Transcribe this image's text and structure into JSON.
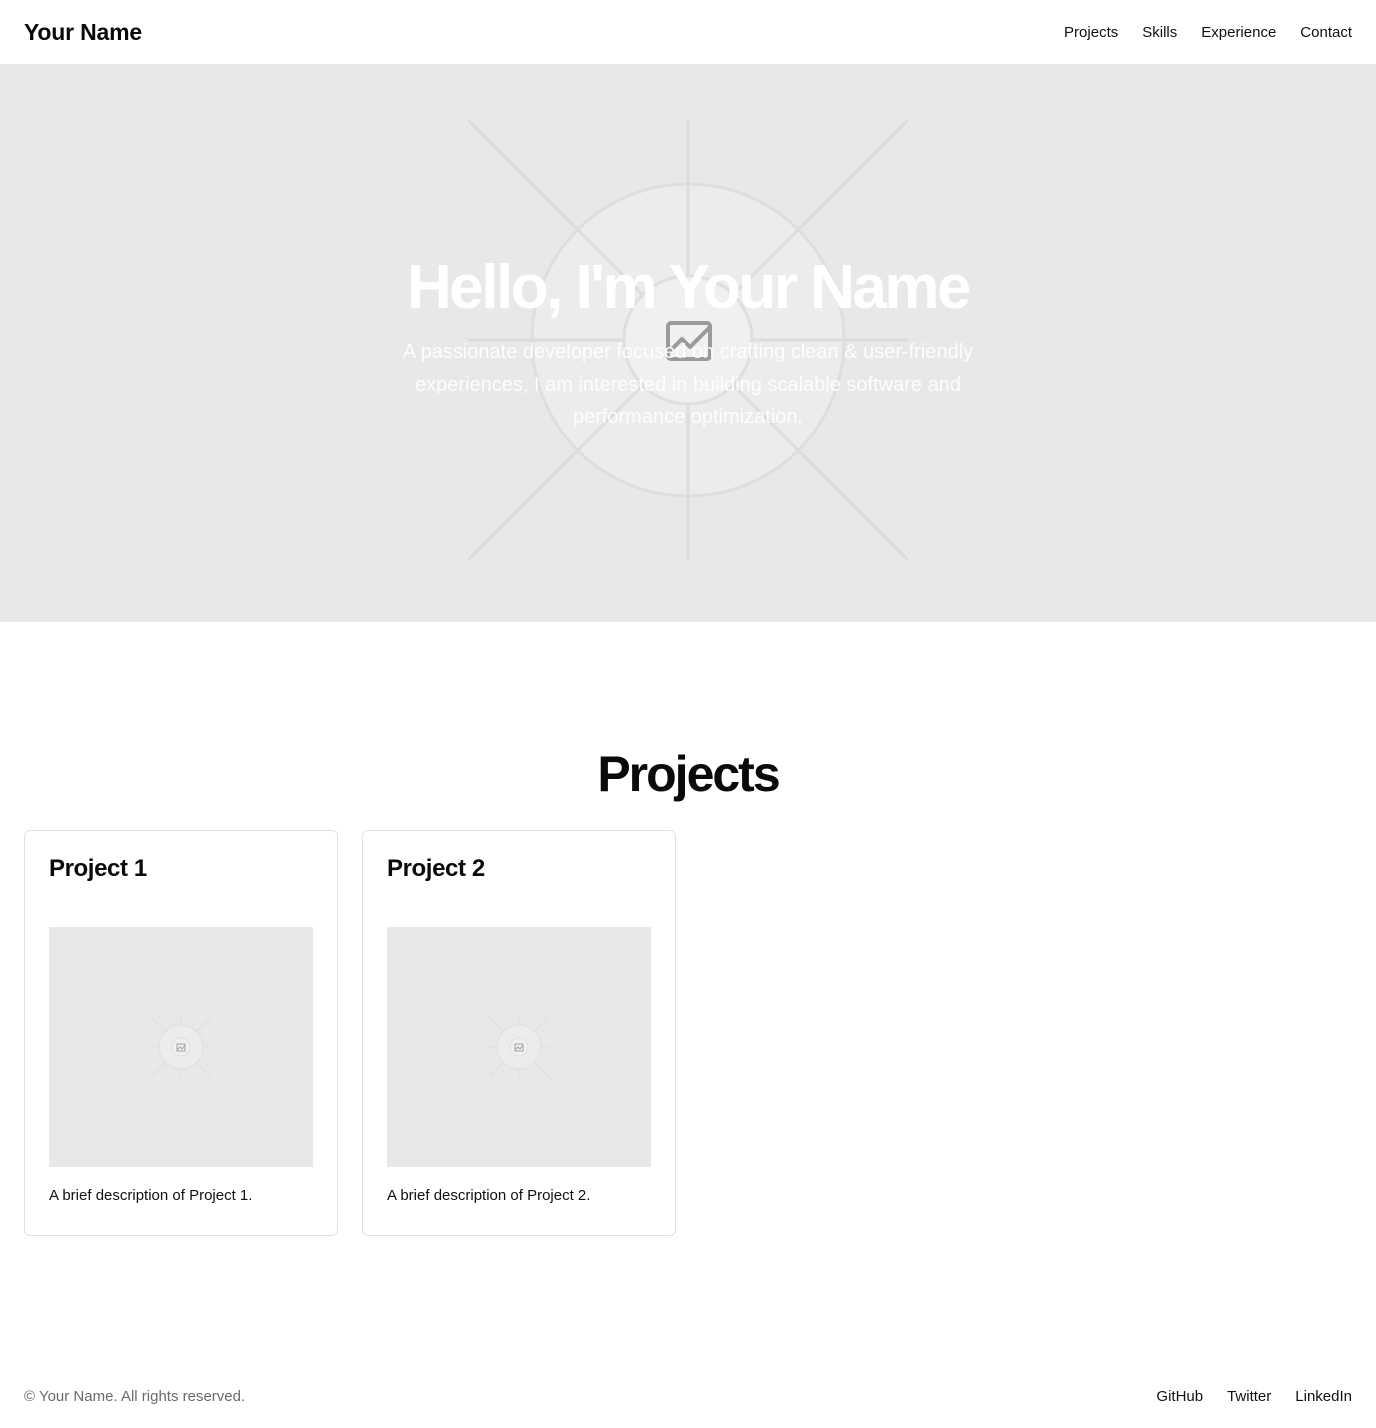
{
  "header": {
    "brand": "Your Name",
    "nav": [
      "Projects",
      "Skills",
      "Experience",
      "Contact"
    ]
  },
  "hero": {
    "title": "Hello, I'm Your Name",
    "subtitle": "A passionate developer focused on crafting clean & user-friendly experiences, I am interested in building scalable software and performance optimization.",
    "image_icon": "image-placeholder-icon"
  },
  "projects": {
    "title": "Projects",
    "items": [
      {
        "title": "Project 1",
        "description": "A brief description of Project 1.",
        "image_icon": "image-placeholder-icon"
      },
      {
        "title": "Project 2",
        "description": "A brief description of Project 2.",
        "image_icon": "image-placeholder-icon"
      }
    ]
  },
  "footer": {
    "copyright": "© Your Name. All rights reserved.",
    "links": [
      "GitHub",
      "Twitter",
      "LinkedIn"
    ]
  },
  "colors": {
    "placeholder_bg": "#e8e8e8",
    "text": "#0a0a0a",
    "muted": "#6b6b6b",
    "border": "#e2e2e2"
  }
}
